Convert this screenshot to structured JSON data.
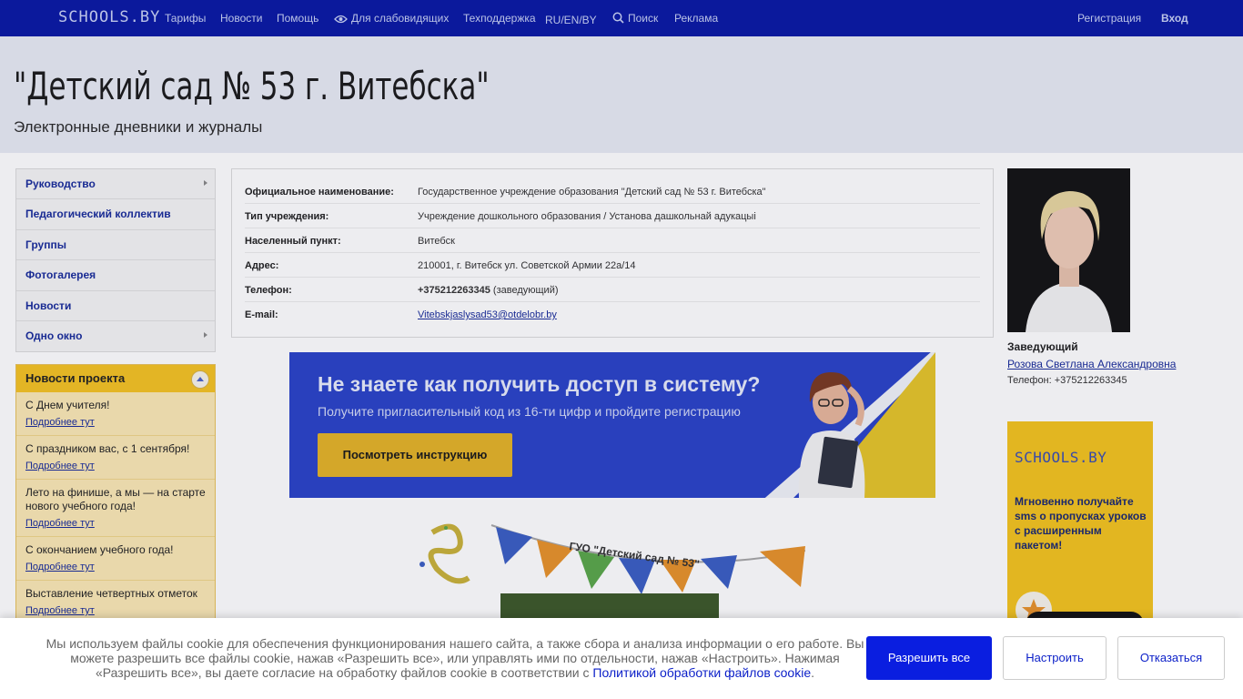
{
  "topbar": {
    "logo": "SCHOOLS.BY",
    "links": [
      "Тарифы",
      "Новости",
      "Помощь",
      "Для слабовидящих",
      "Техподдержка",
      "RU/EN/BY",
      "Поиск",
      "Реклама"
    ],
    "register": "Регистрация",
    "login": "Вход"
  },
  "header": {
    "title": "\"Детский сад № 53 г. Витебска\"",
    "subtitle": "Электронные дневники и журналы"
  },
  "menu": {
    "items": [
      "Руководство",
      "Педагогический коллектив",
      "Группы",
      "Фотогалерея",
      "Новости",
      "Одно окно"
    ]
  },
  "news": {
    "title": "Новости проекта",
    "more_label": "Подробнее тут",
    "items": [
      "С Днем учителя!",
      "С праздником вас, с 1 сентября!",
      "Лето на финише, а мы — на старте нового учебного года!",
      "С окончанием учебного года!",
      "Выставление четвертных отметок"
    ]
  },
  "info": {
    "rows": [
      {
        "label": "Официальное наименование:",
        "value": "Государственное учреждение образования \"Детский сад № 53 г. Витебска\""
      },
      {
        "label": "Тип учреждения:",
        "value": "Учреждение дошкольного образования / Установа дашкольнай адукацыі"
      },
      {
        "label": "Населенный пункт:",
        "value": "Витебск"
      },
      {
        "label": "Адрес:",
        "value": "210001, г. Витебск ул. Советской Армии 22а/14"
      },
      {
        "label": "Телефон:",
        "value": "+375212263345",
        "note": "(заведующий)"
      },
      {
        "label": "E-mail:",
        "value": "Vitebskjaslysad53@otdelobr.by"
      }
    ]
  },
  "banner": {
    "title": "Не знаете как получить доступ в систему?",
    "subtitle": "Получите пригласительный код из 16-ти цифр и пройдите регистрацию",
    "button": "Посмотреть инструкцию"
  },
  "festive": {
    "caption": "ГУО \"Детский сад № 53\""
  },
  "head": {
    "role": "Заведующий",
    "name": "Розова Светлана Александровна",
    "phone": "Телефон: +375212263345"
  },
  "ad": {
    "logo": "SCHOOLS.BY",
    "text": "Мгновенно получайте sms о пропусках уроков с расширенным пакетом!"
  },
  "cookie": {
    "text": "Мы используем файлы cookie для обеспечения функционирования нашего сайта, а также сбора и анализа информации о его работе. Вы можете разрешить все файлы cookie, нажав «Разрешить все», или управлять ими по отдельности, нажав «Настроить». Нажимая «Разрешить все», вы даете согласие на обработку файлов cookie в соответствии с",
    "link": "Политикой обработки файлов cookie",
    "allow": "Разрешить все",
    "configure": "Настроить",
    "deny": "Отказаться"
  },
  "colors": {
    "topbar": "#0a1aa4",
    "link": "#1a2d9b",
    "news_header": "#f5c323",
    "banner": "#2b44c8",
    "cookie_button": "#0a1ee0"
  }
}
